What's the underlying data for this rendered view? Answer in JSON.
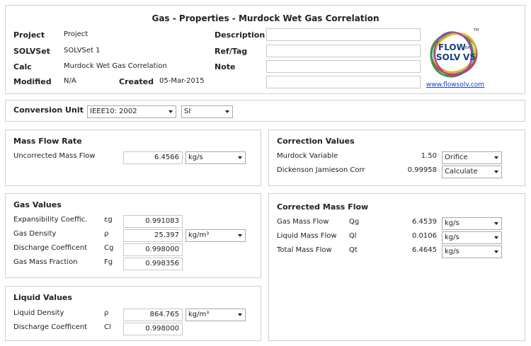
{
  "header": {
    "title": "Gas - Properties - Murdock Wet Gas Correlation",
    "project_label": "Project",
    "project_value": "Project",
    "solvset_label": "SOLVSet",
    "solvset_value": "SOLVSet 1",
    "calc_label": "Calc",
    "calc_value": "Murdock Wet Gas Correlation",
    "modified_label": "Modified",
    "modified_value": "N/A",
    "created_label": "Created",
    "created_value": "05-Mar-2015",
    "description_label": "Description",
    "description_value": "",
    "reftag_label": "Ref/Tag",
    "reftag_value": "",
    "note_label": "Note",
    "note_value": "",
    "logo_text_1": "FLOW",
    "logo_text_2": "SOLV",
    "logo_ba": "BA",
    "logo_v5": "V5",
    "logo_tm": "TM",
    "link": "www.flowsolv.com"
  },
  "conversion": {
    "label": "Conversion Unit",
    "standard": "IEEE10: 2002",
    "system": "SI"
  },
  "mass_flow": {
    "title": "Mass Flow Rate",
    "uncorrected_label": "Uncorrected Mass Flow",
    "uncorrected_value": "6.4566",
    "uncorrected_unit": "kg/s"
  },
  "gas_values": {
    "title": "Gas Values",
    "rows": [
      {
        "label": "Expansibility Coeffic.",
        "symbol": "εg",
        "value": "0.991083",
        "unit": ""
      },
      {
        "label": "Gas Density",
        "symbol": "ρ",
        "value": "25.397",
        "unit": "kg/m³"
      },
      {
        "label": "Discharge Coefficent",
        "symbol": "Cg",
        "value": "0.998000",
        "unit": ""
      },
      {
        "label": "Gas Mass Fraction",
        "symbol": "Fg",
        "value": "0.998356",
        "unit": ""
      }
    ]
  },
  "liquid_values": {
    "title": "Liquid Values",
    "rows": [
      {
        "label": "Liquid Density",
        "symbol": "ρ",
        "value": "864.765",
        "unit": "kg/m³"
      },
      {
        "label": "Discharge Coefficent",
        "symbol": "Cl",
        "value": "0.998000",
        "unit": ""
      }
    ]
  },
  "correction": {
    "title": "Correction Values",
    "rows": [
      {
        "label": "Murdock Variable",
        "value": "1.50",
        "option": "Orifice"
      },
      {
        "label": "Dickenson Jamieson Corr",
        "value": "0.99958",
        "option": "Calculate"
      }
    ]
  },
  "corrected": {
    "title": "Corrected Mass Flow",
    "rows": [
      {
        "label": "Gas Mass Flow",
        "symbol": "Qg",
        "value": "6.4539",
        "unit": "kg/s"
      },
      {
        "label": "Liquid Mass Flow",
        "symbol": "Ql",
        "value": "0.0106",
        "unit": "kg/s"
      },
      {
        "label": "Total Mass Flow",
        "symbol": "Qt",
        "value": "6.4645",
        "unit": "kg/s"
      }
    ]
  }
}
